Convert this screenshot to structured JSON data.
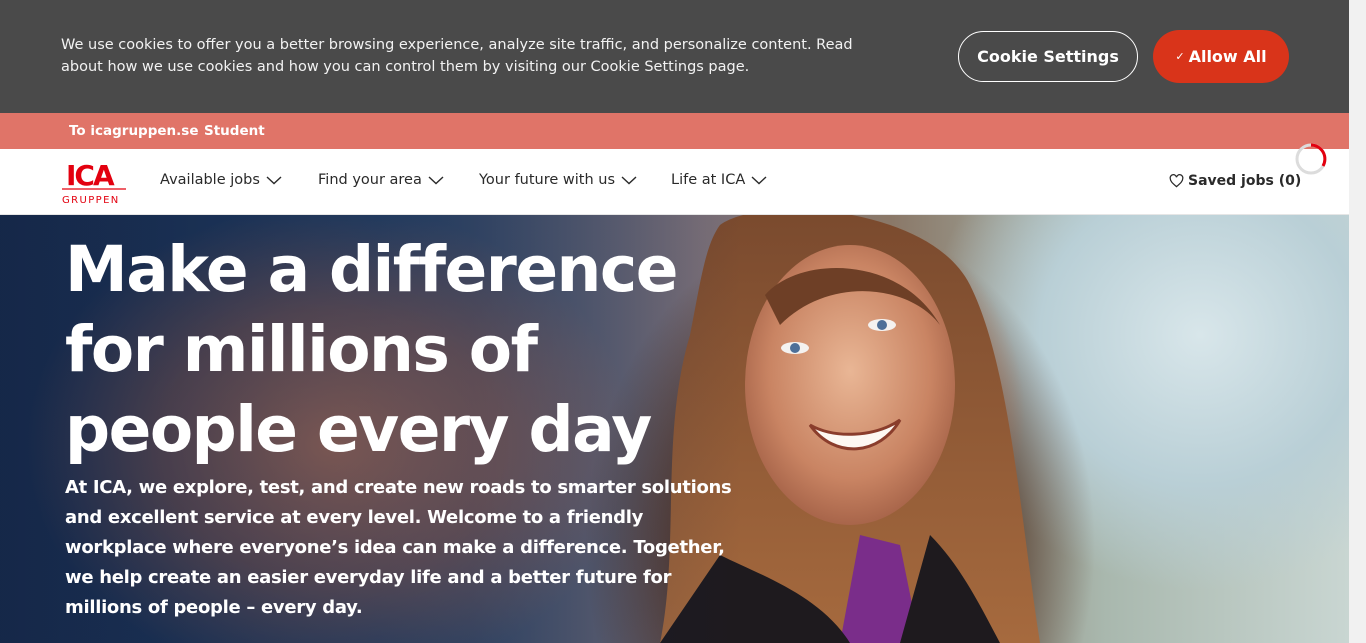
{
  "cookie_banner": {
    "text": "We use cookies to offer you a better browsing experience, analyze site traffic, and personalize content. Read about how we use cookies and how you can control them by visiting our Cookie Settings page.",
    "settings_label": "Cookie Settings",
    "allow_label": "Allow All",
    "allow_check": "✓"
  },
  "top_links": [
    "To icagruppen.se",
    "Student"
  ],
  "logo": {
    "mark": "ICA",
    "sub": "GRUPPEN"
  },
  "nav": {
    "items": [
      "Available jobs",
      "Find your area",
      "Your future with us",
      "Life at ICA"
    ],
    "saved_jobs": "Saved jobs (0)"
  },
  "hero": {
    "title": "Make a difference for millions of people every day",
    "text": "At ICA, we explore, test, and create new roads to smarter solutions and excellent service at every level. Welcome to a friendly workplace where everyone’s idea can make a difference. Together, we help create an easier everyday life and a better future for millions of people – every day."
  },
  "colors": {
    "banner_bg": "#4a4a4a",
    "accent": "#d9341a",
    "strip_bg": "#e07468",
    "brand_red": "#e3000f"
  },
  "icons": [
    "chevron-down-icon",
    "heart-icon",
    "loading-spinner-icon",
    "check-icon"
  ]
}
